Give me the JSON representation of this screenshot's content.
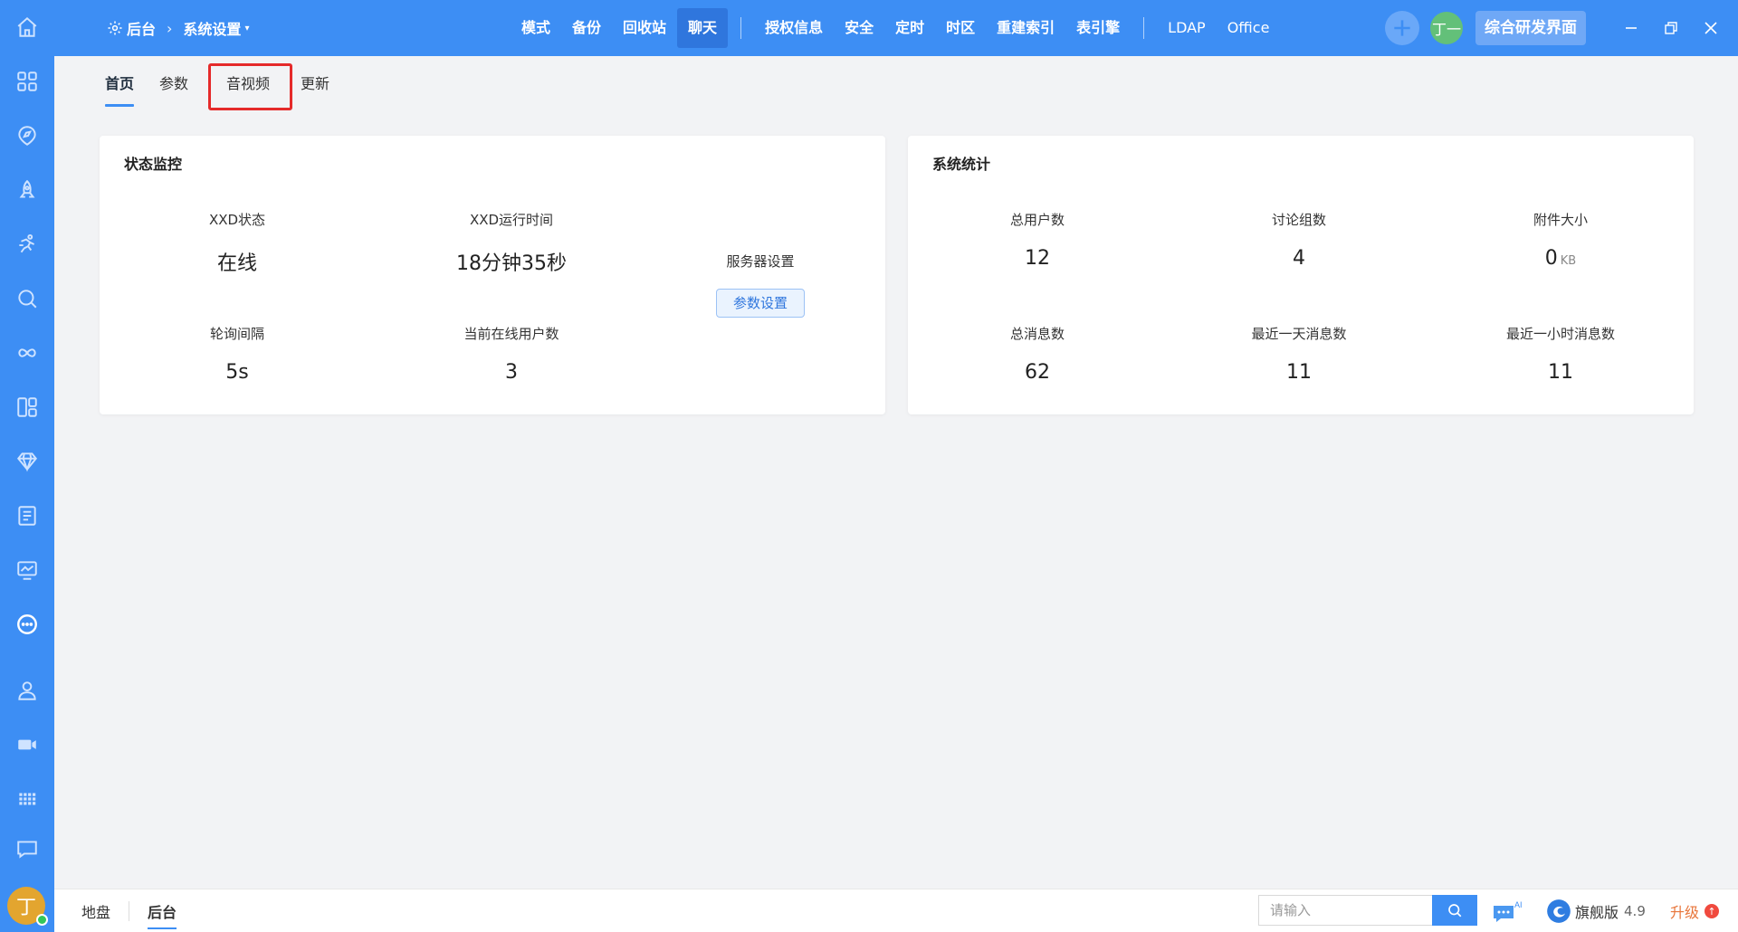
{
  "topbar": {
    "breadcrumb_root": "后台",
    "breadcrumb_current": "系统设置",
    "nav_items": [
      "模式",
      "备份",
      "回收站",
      "聊天",
      "授权信息",
      "安全",
      "定时",
      "时区",
      "重建索引",
      "表引擎",
      "LDAP",
      "Office"
    ],
    "active_nav": "聊天",
    "user_avatar_text": "丁一",
    "workspace_button": "综合研发界面"
  },
  "subtabs": {
    "items": [
      "首页",
      "参数",
      "音视频",
      "更新"
    ],
    "active": "首页",
    "highlighted": "音视频"
  },
  "status_card": {
    "title": "状态监控",
    "xxd_status_label": "XXD状态",
    "xxd_status_value": "在线",
    "uptime_label": "XXD运行时间",
    "uptime_value": "18分钟35秒",
    "server_setting_label": "服务器设置",
    "param_button": "参数设置",
    "poll_label": "轮询间隔",
    "poll_value": "5s",
    "online_users_label": "当前在线用户数",
    "online_users_value": "3"
  },
  "stats_card": {
    "title": "系统统计",
    "total_users_label": "总用户数",
    "total_users_value": "12",
    "groups_label": "讨论组数",
    "groups_value": "4",
    "attachment_label": "附件大小",
    "attachment_value": "0",
    "attachment_unit": "KB",
    "total_msgs_label": "总消息数",
    "total_msgs_value": "62",
    "day_msgs_label": "最近一天消息数",
    "day_msgs_value": "11",
    "hour_msgs_label": "最近一小时消息数",
    "hour_msgs_value": "11"
  },
  "sidebar": {
    "avatar_text": "丁",
    "icons": [
      "home-icon",
      "apps-icon",
      "compass-icon",
      "rocket-icon",
      "run-icon",
      "search-icon",
      "infinity-icon",
      "layout-icon",
      "diamond-icon",
      "list-icon",
      "monitor-icon",
      "chat-dots-icon",
      "user-icon",
      "video-icon",
      "grid-icon",
      "message-icon"
    ]
  },
  "bottombar": {
    "tabs": [
      "地盘",
      "后台"
    ],
    "active_tab": "后台",
    "search_placeholder": "请输入",
    "ai_badge": "AI",
    "edition": "旗舰版",
    "version": "4.9",
    "upgrade": "升级"
  },
  "colors": {
    "primary": "#3d8ef4",
    "highlight_border": "#e52a2a",
    "upgrade": "#e8753a"
  }
}
